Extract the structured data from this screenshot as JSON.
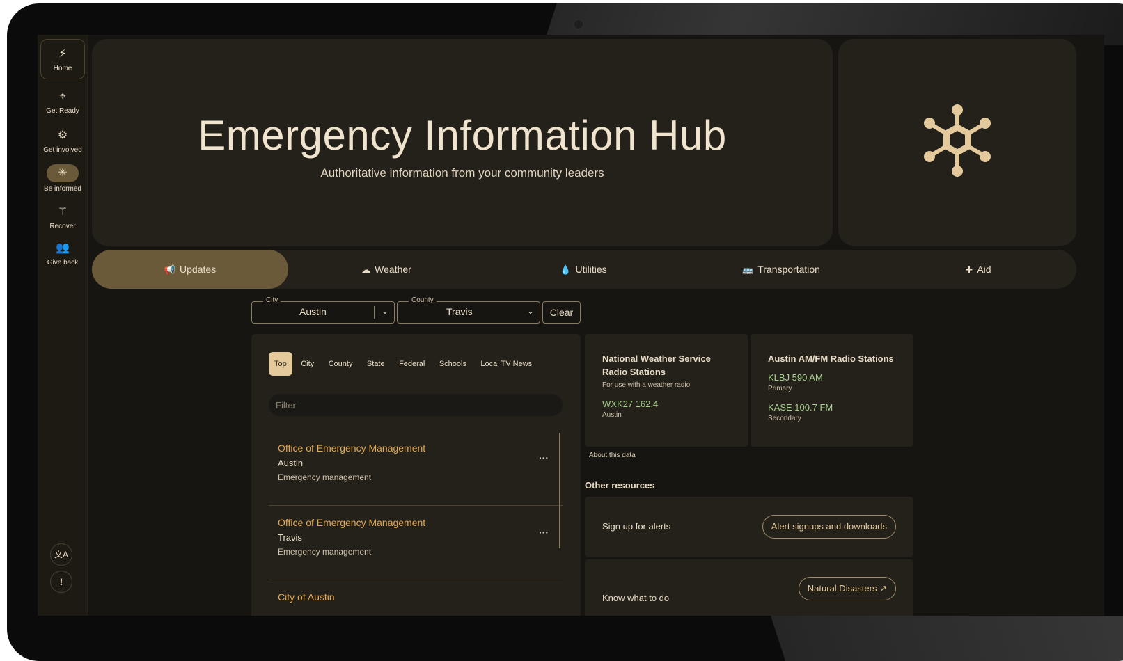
{
  "sidebar": {
    "items": [
      {
        "label": "Home",
        "icon": "⚡"
      },
      {
        "label": "Get Ready",
        "icon": "⌖"
      },
      {
        "label": "Get involved",
        "icon": "⚙"
      },
      {
        "label": "Be informed",
        "icon": "✳"
      },
      {
        "label": "Recover",
        "icon": "⚚"
      },
      {
        "label": "Give back",
        "icon": "👥"
      }
    ],
    "translate_icon": "文A",
    "feedback_icon": "!"
  },
  "hero": {
    "title": "Emergency Information Hub",
    "subtitle": "Authoritative information from your community leaders"
  },
  "tabs": [
    {
      "label": "Updates",
      "icon": "📢"
    },
    {
      "label": "Weather",
      "icon": "☁"
    },
    {
      "label": "Utilities",
      "icon": "💧"
    },
    {
      "label": "Transportation",
      "icon": "🚌"
    },
    {
      "label": "Aid",
      "icon": "✚"
    }
  ],
  "filters": {
    "city_legend": "City",
    "city_value": "Austin",
    "county_legend": "County",
    "county_value": "Travis",
    "clear_label": "Clear"
  },
  "chips": [
    "Top",
    "City",
    "County",
    "State",
    "Federal",
    "Schools",
    "Local TV News"
  ],
  "filter_placeholder": "Filter",
  "orgs": [
    {
      "name": "Office of Emergency Management",
      "place": "Austin",
      "kind": "Emergency management"
    },
    {
      "name": "Office of Emergency Management",
      "place": "Travis",
      "kind": "Emergency management"
    },
    {
      "name": "City of Austin",
      "place": "",
      "kind": ""
    }
  ],
  "nws": {
    "title": "National Weather Service Radio Stations",
    "sub": "For use with a weather radio",
    "stations": [
      {
        "freq": "WXK27 162.4",
        "loc": "Austin"
      }
    ]
  },
  "amfm": {
    "title": "Austin AM/FM Radio Stations",
    "stations": [
      {
        "freq": "KLBJ 590 AM",
        "loc": "Primary"
      },
      {
        "freq": "KASE 100.7 FM",
        "loc": "Secondary"
      }
    ]
  },
  "about_label": "About this data",
  "other_resources": "Other resources",
  "resources": [
    {
      "label": "Sign up for alerts",
      "button": "Alert signups and downloads"
    },
    {
      "label": "Know what to do",
      "button": "Natural Disasters"
    }
  ],
  "colors": {
    "accent": "#6b5a3a",
    "link": "#e3a84f",
    "station": "#a7cf8e",
    "chip_active": "#e3c99b"
  }
}
